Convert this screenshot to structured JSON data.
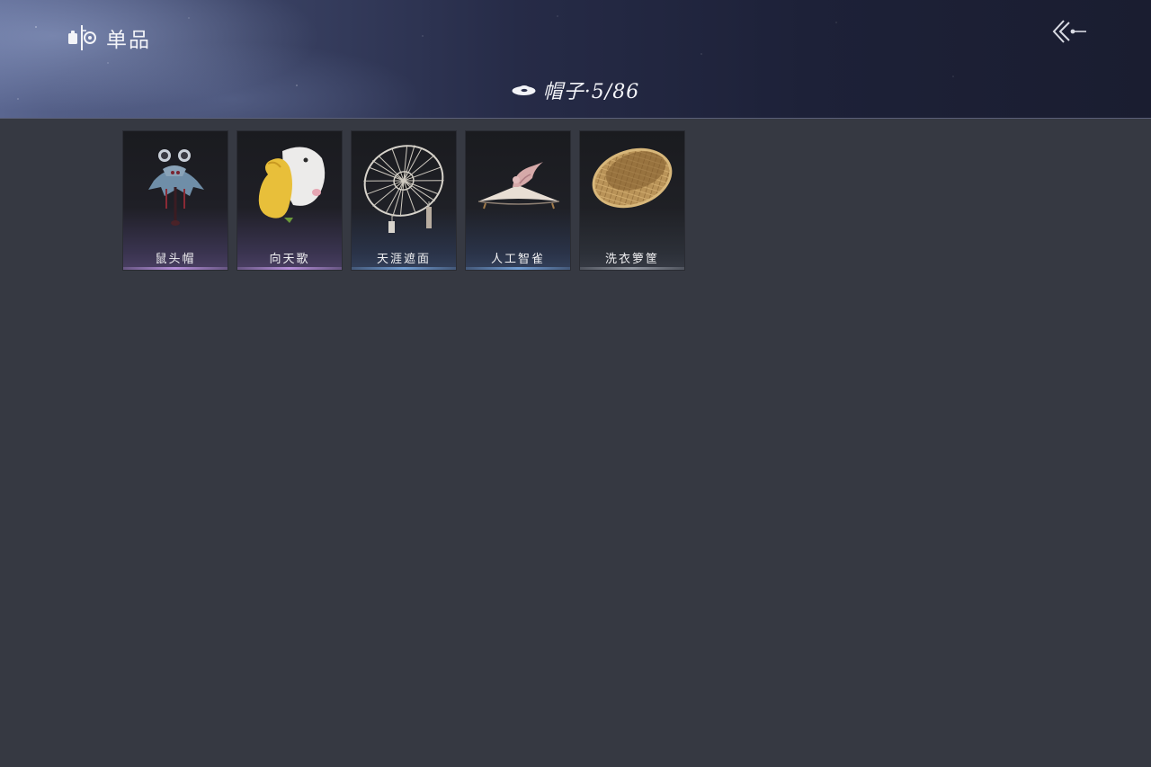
{
  "header": {
    "title": "单品",
    "category_label": "帽子·5/86",
    "icons": {
      "brand": "item-collection-icon",
      "back": "back-arrow-icon",
      "category": "hat-icon"
    }
  },
  "items": [
    {
      "label": "鼠头帽",
      "rarity_color": "#b48fd8",
      "icon": "mouse-head-hat-icon"
    },
    {
      "label": "向天歌",
      "rarity_color": "#b48fd8",
      "icon": "goose-hat-icon"
    },
    {
      "label": "天涯遮面",
      "rarity_color": "#6f9bd0",
      "icon": "spoked-veil-hat-icon"
    },
    {
      "label": "人工智雀",
      "rarity_color": "#6f9bd0",
      "icon": "bird-hat-icon"
    },
    {
      "label": "洗衣箩筐",
      "rarity_color": "#8f949e",
      "icon": "basket-hat-icon"
    }
  ]
}
